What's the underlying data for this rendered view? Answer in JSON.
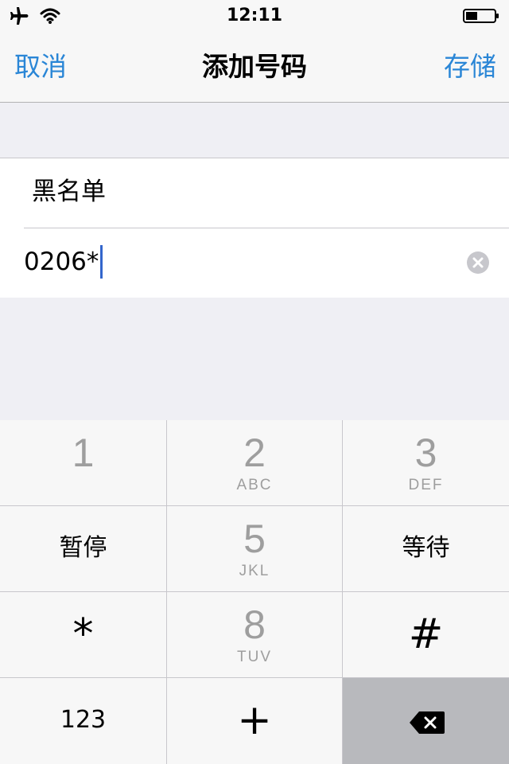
{
  "status": {
    "time": "12:11"
  },
  "nav": {
    "cancel_label": "取消",
    "title": "添加号码",
    "save_label": "存储"
  },
  "form": {
    "name_label": "黑名单",
    "number_value": "0206*"
  },
  "keypad": {
    "key_1": {
      "digit": "1",
      "letters": ""
    },
    "key_2": {
      "digit": "2",
      "letters": "ABC"
    },
    "key_3": {
      "digit": "3",
      "letters": "DEF"
    },
    "pause": "暂停",
    "key_5": {
      "digit": "5",
      "letters": "JKL"
    },
    "wait": "等待",
    "star": "*",
    "key_8": {
      "digit": "8",
      "letters": "TUV"
    },
    "hash": "#",
    "mode_123": "123",
    "plus": "+"
  },
  "colors": {
    "accent": "#2a86d6",
    "caret": "#3366cc",
    "keypad_digit": "#9e9e9e",
    "delete_key_bg": "#b8b9bd"
  }
}
